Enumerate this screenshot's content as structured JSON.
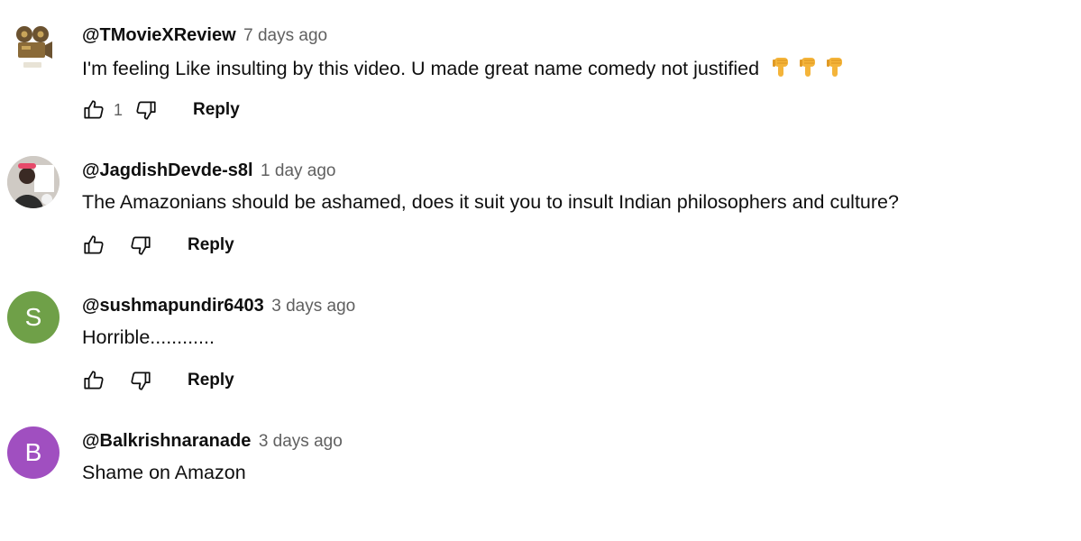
{
  "comments": [
    {
      "author": "@TMovieXReview",
      "time": "7 days ago",
      "text": "I'm feeling Like insulting by this video. U made great name comedy not justified",
      "emojis": [
        "thumbs-down-emoji",
        "thumbs-down-emoji",
        "thumbs-down-emoji"
      ],
      "likes": "1",
      "reply_label": "Reply",
      "avatar": {
        "type": "image",
        "icon": "movie-camera-icon"
      }
    },
    {
      "author": "@JagdishDevde-s8l",
      "time": "1 day ago",
      "text": "The Amazonians should be ashamed, does it suit you to insult Indian philosophers and culture?",
      "likes": "",
      "reply_label": "Reply",
      "avatar": {
        "type": "image",
        "icon": "photo-avatar-icon"
      }
    },
    {
      "author": "@sushmapundir6403",
      "time": "3 days ago",
      "text": "Horrible............",
      "likes": "",
      "reply_label": "Reply",
      "avatar": {
        "type": "letter",
        "letter": "S",
        "color": "#6fa048"
      }
    },
    {
      "author": "@Balkrishnaranade",
      "time": "3 days ago",
      "text": "Shame on Amazon",
      "avatar": {
        "type": "letter",
        "letter": "B",
        "color": "#a04fc0"
      }
    }
  ],
  "colors": {
    "text": "#0f0f0f",
    "secondary": "#606060",
    "emoji": "#f4b43a"
  }
}
